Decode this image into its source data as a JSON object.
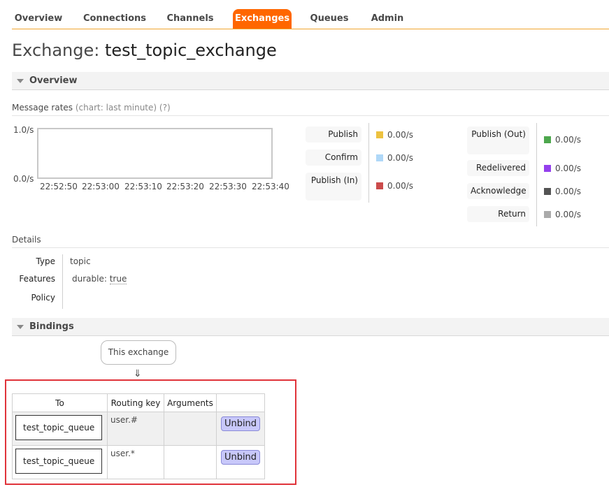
{
  "nav": {
    "tabs": [
      {
        "label": "Overview",
        "active": false
      },
      {
        "label": "Connections",
        "active": false
      },
      {
        "label": "Channels",
        "active": false
      },
      {
        "label": "Exchanges",
        "active": true
      },
      {
        "label": "Queues",
        "active": false
      },
      {
        "label": "Admin",
        "active": false
      }
    ],
    "accent_color": "#ff6600"
  },
  "page": {
    "title_prefix": "Exchange:",
    "exchange_name": "test_topic_exchange"
  },
  "overview": {
    "header": "Overview",
    "message_rates_label": "Message rates",
    "chart_note": "(chart: last minute)",
    "help": "(?)",
    "chart": {
      "y_max_label": "1.0/s",
      "y_min_label": "0.0/s",
      "x_ticks": [
        "22:52:50",
        "22:53:00",
        "22:53:10",
        "22:53:20",
        "22:53:30",
        "22:53:40"
      ]
    },
    "rates_left": [
      {
        "label": "Publish",
        "value": "0.00/s",
        "color": "#edc240"
      },
      {
        "label": "Confirm",
        "value": "0.00/s",
        "color": "#afd8f8"
      },
      {
        "label": "Publish (In)",
        "value": "0.00/s",
        "color": "#cb4b4b"
      }
    ],
    "rates_right": [
      {
        "label": "Publish (Out)",
        "value": "0.00/s",
        "color": "#4da74d"
      },
      {
        "label": "Redelivered",
        "value": "0.00/s",
        "color": "#9440ed"
      },
      {
        "label": "Acknowledge",
        "value": "0.00/s",
        "color": "#545454"
      },
      {
        "label": "Return",
        "value": "0.00/s",
        "color": "#aaaaaa"
      }
    ]
  },
  "details": {
    "header": "Details",
    "type_label": "Type",
    "type_value": "topic",
    "features_label": "Features",
    "features_key": "durable:",
    "features_value": "true",
    "policy_label": "Policy",
    "policy_value": ""
  },
  "bindings": {
    "header": "Bindings",
    "this_exchange": "This exchange",
    "arrow": "⇓",
    "columns": [
      "To",
      "Routing key",
      "Arguments",
      ""
    ],
    "rows": [
      {
        "to": "test_topic_queue",
        "routing_key": "user.#",
        "arguments": "",
        "action": "Unbind"
      },
      {
        "to": "test_topic_queue",
        "routing_key": "user.*",
        "arguments": "",
        "action": "Unbind"
      }
    ]
  }
}
